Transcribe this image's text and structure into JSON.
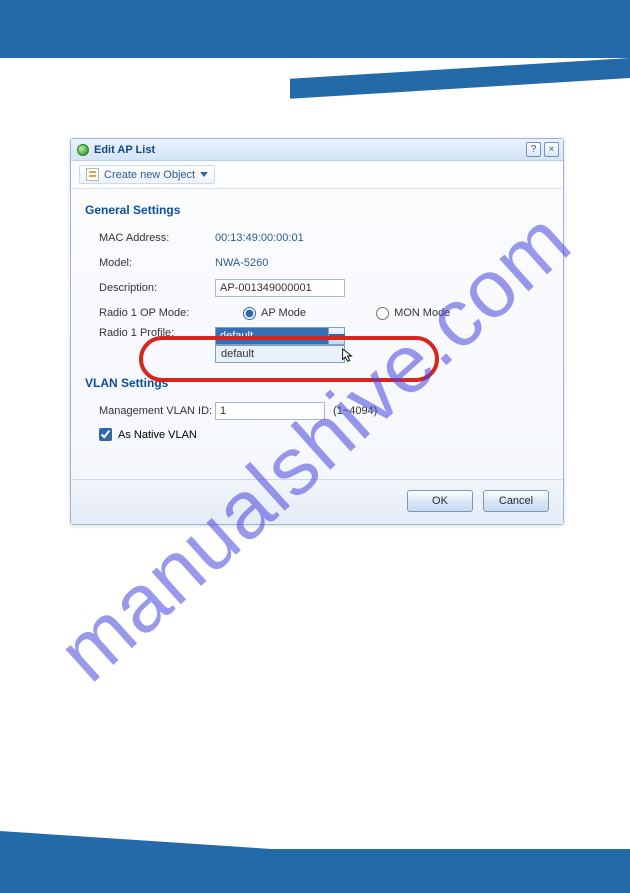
{
  "watermark": "manualshive.com",
  "dialog": {
    "title": "Edit AP List",
    "create_object": "Create new Object",
    "sections": {
      "general": "General Settings",
      "vlan": "VLAN Settings"
    },
    "fields": {
      "mac_label": "MAC Address:",
      "mac_value": "00:13:49:00:00:01",
      "model_label": "Model:",
      "model_value": "NWA-5260",
      "desc_label": "Description:",
      "desc_value": "AP-001349000001",
      "opmode_label": "Radio 1 OP Mode:",
      "opmode_ap": "AP Mode",
      "opmode_mon": "MON Mode",
      "profile_label": "Radio 1 Profile:",
      "profile_value": "default",
      "profile_option": "default",
      "vlan_id_label": "Management VLAN ID:",
      "vlan_id_value": "1",
      "vlan_range": "(1~4094)",
      "native_vlan": "As Native VLAN"
    },
    "buttons": {
      "ok": "OK",
      "cancel": "Cancel"
    }
  }
}
